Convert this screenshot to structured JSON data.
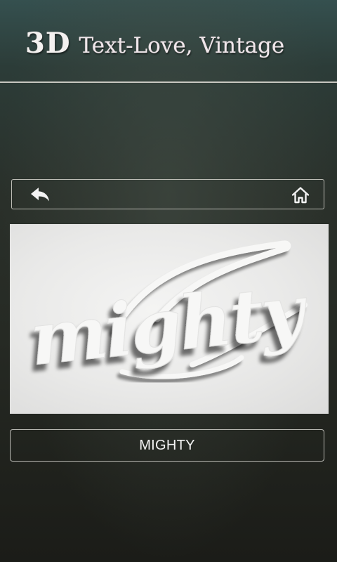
{
  "header": {
    "title_3d": "3D",
    "title_rest": "Text-Love, Vintage"
  },
  "nav": {
    "back_icon": "back-arrow-icon",
    "home_icon": "home-icon"
  },
  "preview": {
    "text": "mighty"
  },
  "style_button": {
    "label": "MIGHTY"
  },
  "colors": {
    "title": "#f4f1f0",
    "border": "#bdbdb6",
    "preview_bg": "#eeeeed",
    "text_relief": "#f7f7f6"
  }
}
